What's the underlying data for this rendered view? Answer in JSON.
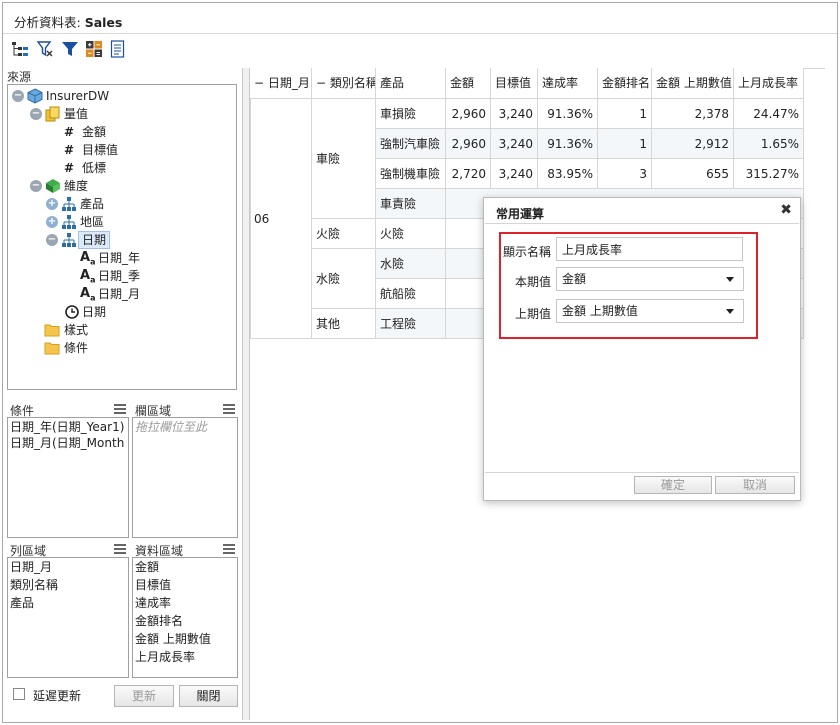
{
  "window": {
    "title_prefix": "分析資料表: ",
    "title_name": "Sales"
  },
  "toolbar": {
    "buttons": [
      "tree-layout-icon",
      "filter-clear-icon",
      "filter-icon",
      "calculator-icon",
      "report-icon"
    ]
  },
  "source": {
    "label": "來源",
    "root": "InsurerDW",
    "measures_label": "量值",
    "measures": [
      "金額",
      "目標值",
      "低標"
    ],
    "dimensions_label": "維度",
    "dimension_items": [
      "產品",
      "地區",
      "日期"
    ],
    "date_levels": [
      "日期_年",
      "日期_季",
      "日期_月"
    ],
    "date_hierarchy": "日期",
    "folders": [
      "樣式",
      "條件"
    ]
  },
  "zones": {
    "filter": {
      "label": "條件",
      "items": [
        "日期_年(日期_Year1)",
        "日期_月(日期_Month"
      ]
    },
    "column": {
      "label": "欄區域",
      "placeholder": "拖拉欄位至此"
    },
    "row": {
      "label": "列區域",
      "items": [
        "日期_月",
        "類別名稱",
        "產品"
      ]
    },
    "data": {
      "label": "資料區域",
      "items": [
        "金額",
        "目標值",
        "達成率",
        "金額排名",
        "金額 上期數值",
        "上月成長率"
      ]
    }
  },
  "bottom": {
    "delay_update_label": "延遲更新",
    "update_label": "更新",
    "close_label": "關閉"
  },
  "grid": {
    "headers": [
      "− 日期_月",
      "− 類別名稱",
      "產品",
      "金額",
      "目標值",
      "達成率",
      "金額排名",
      "金額 上期數值",
      "上月成長率"
    ],
    "month": "06",
    "categories": [
      "車險",
      "火險",
      "水險",
      "其他"
    ],
    "rows": [
      {
        "product": "車損險",
        "amount": "2,960",
        "target": "3,240",
        "rate": "91.36%",
        "rank": "1",
        "prev": "2,378",
        "growth": "24.47%"
      },
      {
        "product": "強制汽車險",
        "amount": "2,960",
        "target": "3,240",
        "rate": "91.36%",
        "rank": "1",
        "prev": "2,912",
        "growth": "1.65%"
      },
      {
        "product": "強制機車險",
        "amount": "2,720",
        "target": "3,240",
        "rate": "83.95%",
        "rank": "3",
        "prev": "655",
        "growth": "315.27%"
      },
      {
        "product": "車責險"
      },
      {
        "product": "火險"
      },
      {
        "product": "水險"
      },
      {
        "product": "航船險"
      },
      {
        "product": "工程險"
      }
    ]
  },
  "dialog": {
    "title": "常用運算",
    "display_name_label": "顯示名稱",
    "display_name_value": "上月成長率",
    "current_label": "本期值",
    "current_value": "金額",
    "previous_label": "上期值",
    "previous_value": "金額 上期數值",
    "ok_label": "確定",
    "cancel_label": "取消"
  },
  "colors": {
    "highlight": "#e0202a",
    "alt_row": "#f4f7fa"
  }
}
